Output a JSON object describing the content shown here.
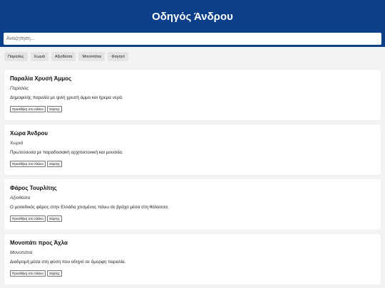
{
  "header": {
    "title": "Οδηγός Άνδρου"
  },
  "search": {
    "placeholder": "Αναζήτηση...",
    "value": ""
  },
  "filters": [
    {
      "label": "Παραλίες"
    },
    {
      "label": "Χωριά"
    },
    {
      "label": "Αξιοθέατα"
    },
    {
      "label": "Μονοπάτια"
    },
    {
      "label": "Φαγητό"
    }
  ],
  "places": [
    {
      "title": "Παραλία Χρυσή Άμμος",
      "category": "Παραλίες",
      "description": "Δημοφιλής παραλία με ψιλή χρυσή άμμο και ήρεμα νερά.",
      "add_label": "Προσθήκη στο πλάνο",
      "map_label": "Χάρτης"
    },
    {
      "title": "Χώρα Άνδρου",
      "category": "Χωριά",
      "description": "Πρωτεύουσα με παραδοσιακή αρχιτεκτονική και μουσεία.",
      "add_label": "Προσθήκη στο πλάνο",
      "map_label": "Χάρτης"
    },
    {
      "title": "Φάρος Τουρλίτης",
      "category": "Αξιοθέατα",
      "description": "Ο μοναδικός φάρος στην Ελλάδα χτισμένος πάνω σε βράχο μέσα στη θάλασσα.",
      "add_label": "Προσθήκη στο πλάνο",
      "map_label": "Χάρτης"
    },
    {
      "title": "Μονοπάτι προς Άχλα",
      "category": "Μονοπάτια",
      "description": "Διαδρομή μέσα στη φύση που οδηγεί σε όμορφη παραλία.",
      "add_label": "Προσθήκη στο πλάνο",
      "map_label": "Χάρτης"
    }
  ],
  "colors": {
    "header_bg": "#0b3f8a",
    "page_bg": "#f3f3f3",
    "card_bg": "#ffffff"
  }
}
